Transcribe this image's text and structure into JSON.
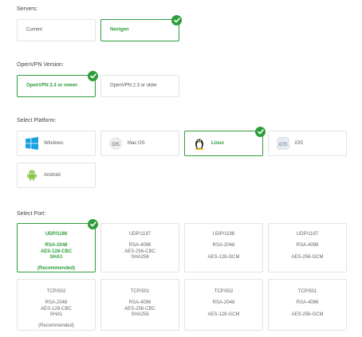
{
  "servers": {
    "label": "Servers:",
    "options": [
      {
        "label": "Current",
        "selected": false
      },
      {
        "label": "Nextgen",
        "selected": true
      }
    ]
  },
  "openvpn": {
    "label": "OpenVPN Version:",
    "options": [
      {
        "label": "OpenVPN 2.4 or newer",
        "selected": true
      },
      {
        "label": "OpenVPN 2.3 or older",
        "selected": false
      }
    ]
  },
  "platform": {
    "label": "Select Platform:",
    "options": [
      {
        "label": "Windows",
        "icon": "windows-icon",
        "selected": false
      },
      {
        "label": "Mac OS",
        "icon": "macos-icon",
        "selected": false
      },
      {
        "label": "Linux",
        "icon": "linux-icon",
        "selected": true
      },
      {
        "label": "iOS",
        "icon": "ios-icon",
        "selected": false
      },
      {
        "label": "Android",
        "icon": "android-icon",
        "selected": false
      }
    ]
  },
  "port": {
    "label": "Select Port:",
    "options": [
      {
        "protocol": "UDP/1198",
        "cipher1": "RSA-2048",
        "cipher2": "AES-128-CBC",
        "cipher3": "SHA1",
        "note": "(Recommended)",
        "selected": true
      },
      {
        "protocol": "UDP/1197",
        "cipher1": "RSA-4096",
        "cipher2": "AES-256-CBC",
        "cipher3": "SHA256",
        "note": "",
        "selected": false
      },
      {
        "protocol": "UDP/1198",
        "cipher1": "RSA-2048",
        "cipher2": "",
        "cipher3": "AES-128-GCM",
        "note": "",
        "selected": false
      },
      {
        "protocol": "UDP/1197",
        "cipher1": "RSA-4096",
        "cipher2": "",
        "cipher3": "AES-256-GCM",
        "note": "",
        "selected": false
      },
      {
        "protocol": "TCP/502",
        "cipher1": "RSA-2048",
        "cipher2": "AES-128-CBC",
        "cipher3": "SHA1",
        "note": "(Recommended)",
        "selected": false
      },
      {
        "protocol": "TCP/501",
        "cipher1": "RSA-4096",
        "cipher2": "AES-256-CBC",
        "cipher3": "SHA256",
        "note": "",
        "selected": false
      },
      {
        "protocol": "TCP/502",
        "cipher1": "RSA-2048",
        "cipher2": "",
        "cipher3": "AES-128-GCM",
        "note": "",
        "selected": false
      },
      {
        "protocol": "TCP/501",
        "cipher1": "RSA-4096",
        "cipher2": "",
        "cipher3": "AES-256-GCM",
        "note": "",
        "selected": false
      }
    ]
  },
  "colors": {
    "accent": "#2e9e3c",
    "border": "#e3e3e3"
  }
}
